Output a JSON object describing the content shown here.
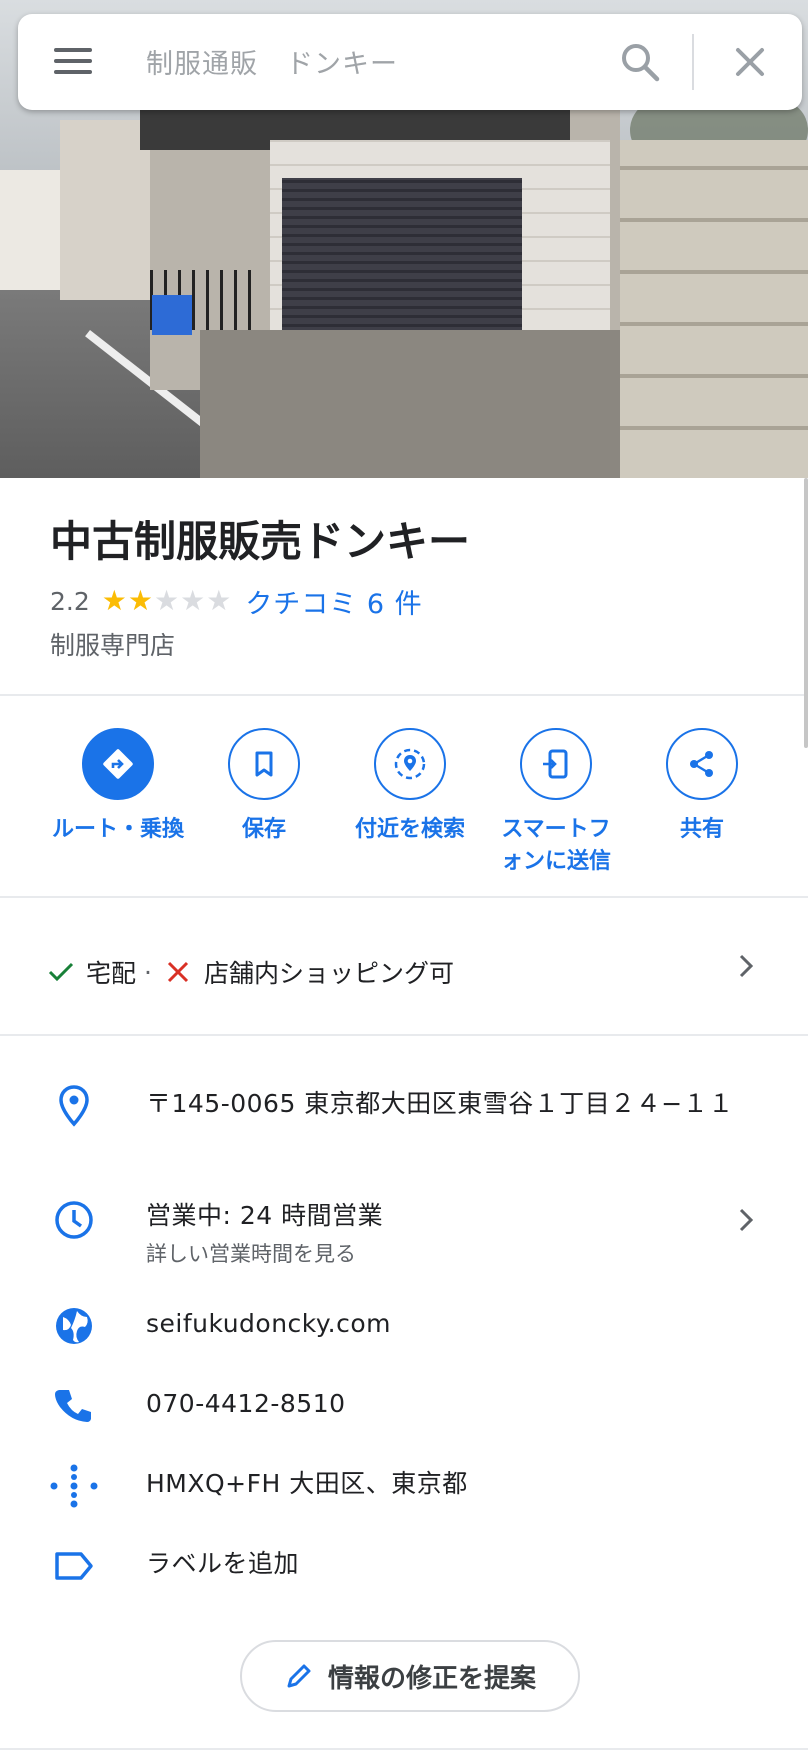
{
  "search": {
    "query": "制服通販　ドンキー"
  },
  "place": {
    "name": "中古制服販売ドンキー",
    "rating": "2.2",
    "rating_value": 2.2,
    "reviews": "クチコミ 6 件",
    "category": "制服専門店"
  },
  "actions": [
    {
      "label": "ルート・乗換",
      "icon": "directions-icon"
    },
    {
      "label": "保存",
      "icon": "bookmark-icon"
    },
    {
      "label": "付近を検索",
      "icon": "nearby-search-icon"
    },
    {
      "label": "スマートフォンに送信",
      "icon": "send-to-phone-icon"
    },
    {
      "label": "共有",
      "icon": "share-icon"
    }
  ],
  "amenities": {
    "delivery": "宅配",
    "separator": "·",
    "in_store": "店舗内ショッピング可"
  },
  "info": {
    "address": "〒145-0065 東京都大田区東雪谷１丁目２４−１１",
    "hours_status": "営業中: 24 時間営業",
    "hours_more": "詳しい営業時間を見る",
    "website": "seifukudoncky.com",
    "phone": "070-4412-8510",
    "plus_code": "HMXQ+FH 大田区、東京都",
    "add_label": "ラベルを追加"
  },
  "suggest_edit": "情報の修正を提案",
  "colors": {
    "accent": "#1a73e8",
    "star": "#fbbc04",
    "check": "#188038",
    "cross": "#d93025",
    "text_secondary": "#5f6368"
  }
}
